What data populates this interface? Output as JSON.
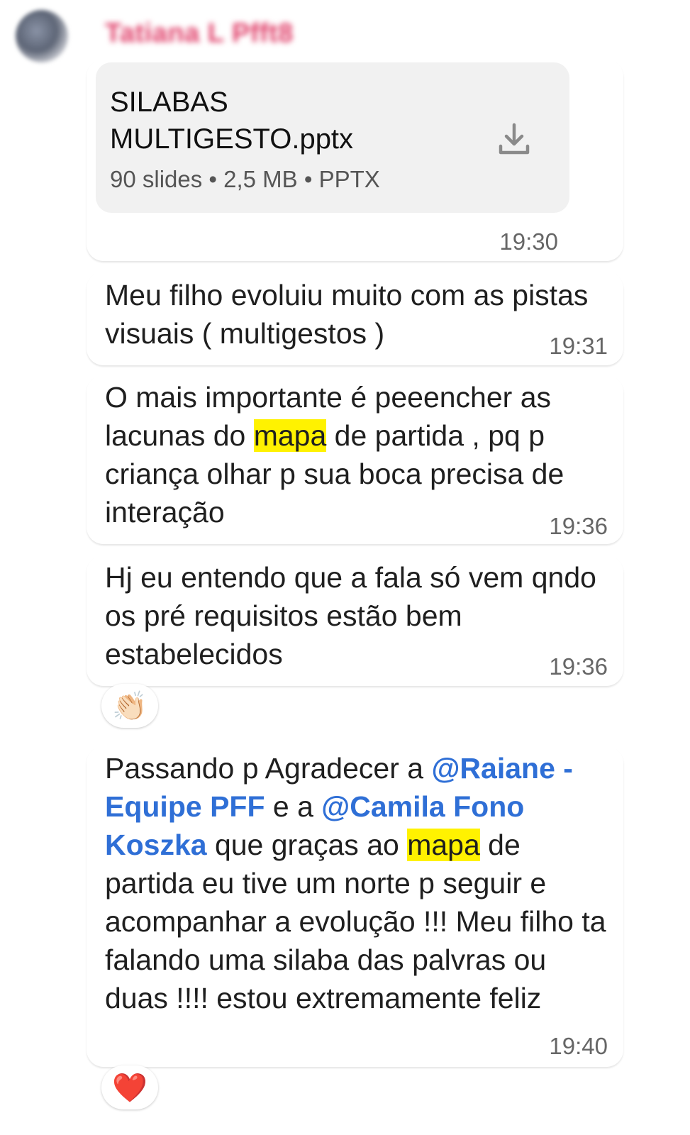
{
  "sender": {
    "name": "Tatiana L Pfft8"
  },
  "file": {
    "name": "SILABAS MULTIGESTO.pptx",
    "meta": "90 slides • 2,5 MB • PPTX",
    "time": "19:30"
  },
  "messages": [
    {
      "text": "Meu filho evoluiu muito com as pistas visuais ( multigestos )",
      "time": "19:31"
    },
    {
      "time": "19:36",
      "parts": [
        "O mais importante é  peeencher as lacunas do ",
        "mapa",
        " de partida , pq p criança olhar p sua boca precisa de interação"
      ]
    },
    {
      "text": "Hj eu entendo que  a fala  só vem qndo os pré requisitos estão bem estabelecidos",
      "time": "19:36",
      "reaction": "👏🏻"
    },
    {
      "time": "19:40",
      "parts": [
        "Passando p Agradecer a ",
        "@Raiane - Equipe PFF",
        "  e a ",
        "@Camila Fono Koszka",
        "  que graças ao ",
        "mapa",
        " de partida eu  tive um norte p seguir e  acompanhar a evolução !!! Meu filho ta falando uma silaba das palvras ou duas !!!! estou extremamente feliz"
      ],
      "reaction": "❤️"
    }
  ],
  "colors": {
    "mention": "#2f6fd6",
    "highlight": "#fff200",
    "sender": "#e0406a"
  }
}
